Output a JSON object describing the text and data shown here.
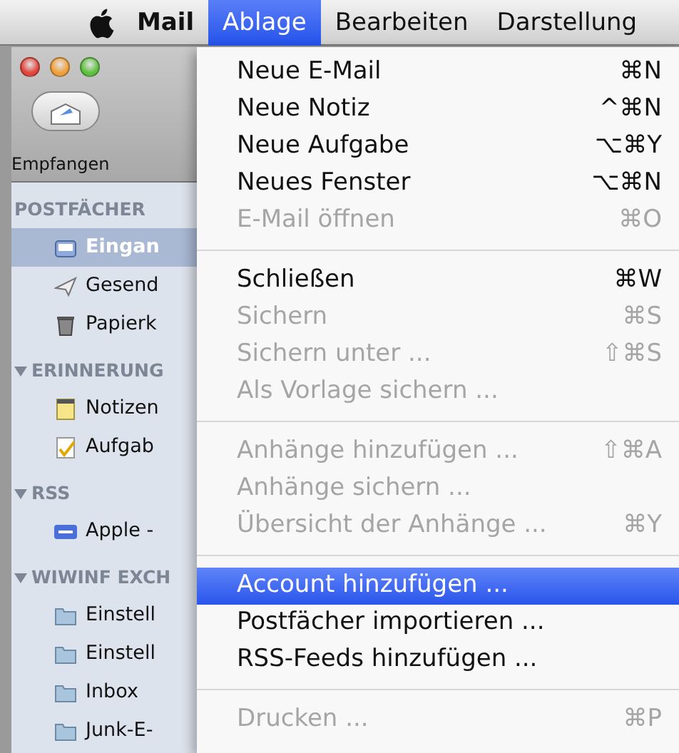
{
  "menu_bar": {
    "app": "Mail",
    "items": [
      {
        "label": "Ablage",
        "selected": true
      },
      {
        "label": "Bearbeiten",
        "selected": false
      },
      {
        "label": "Darstellung",
        "selected": false
      }
    ]
  },
  "sidebar": {
    "toolbar_button": "Empfangen",
    "sections": [
      {
        "title": "POSTFÄCHER",
        "kind": "fixed",
        "expanded": true,
        "items": [
          {
            "label": "Eingan",
            "kind": "inbox",
            "selected": true
          },
          {
            "label": "Gesend",
            "kind": "sent",
            "selected": false
          },
          {
            "label": "Papierk",
            "kind": "trash",
            "selected": false
          }
        ]
      },
      {
        "title": "ERINNERUNG",
        "kind": "collapsible",
        "expanded": true,
        "items": [
          {
            "label": "Notizen",
            "kind": "note",
            "selected": false
          },
          {
            "label": "Aufgab",
            "kind": "todo",
            "selected": false
          }
        ]
      },
      {
        "title": "RSS",
        "kind": "collapsible",
        "expanded": true,
        "items": [
          {
            "label": "Apple -",
            "kind": "rss",
            "selected": false
          }
        ]
      },
      {
        "title": "WIWINF EXCH",
        "kind": "collapsible",
        "expanded": true,
        "items": [
          {
            "label": "Einstell",
            "kind": "folder",
            "selected": false
          },
          {
            "label": "Einstell",
            "kind": "folder",
            "selected": false
          },
          {
            "label": "Inbox",
            "kind": "folder",
            "selected": false
          },
          {
            "label": "Junk-E-",
            "kind": "folder",
            "selected": false
          }
        ]
      }
    ]
  },
  "menu": {
    "items": [
      {
        "kind": "item",
        "label": "Neue E-Mail",
        "shortcut": "⌘N",
        "disabled": false,
        "selected": false
      },
      {
        "kind": "item",
        "label": "Neue Notiz",
        "shortcut": "^⌘N",
        "disabled": false,
        "selected": false
      },
      {
        "kind": "item",
        "label": "Neue Aufgabe",
        "shortcut": "⌥⌘Y",
        "disabled": false,
        "selected": false
      },
      {
        "kind": "item",
        "label": "Neues Fenster",
        "shortcut": "⌥⌘N",
        "disabled": false,
        "selected": false
      },
      {
        "kind": "item",
        "label": "E-Mail öffnen",
        "shortcut": "⌘O",
        "disabled": true,
        "selected": false
      },
      {
        "kind": "separator"
      },
      {
        "kind": "item",
        "label": "Schließen",
        "shortcut": "⌘W",
        "disabled": false,
        "selected": false
      },
      {
        "kind": "item",
        "label": "Sichern",
        "shortcut": "⌘S",
        "disabled": true,
        "selected": false
      },
      {
        "kind": "item",
        "label": "Sichern unter ...",
        "shortcut": "⇧⌘S",
        "disabled": true,
        "selected": false
      },
      {
        "kind": "item",
        "label": "Als Vorlage sichern ...",
        "disabled": true,
        "selected": false
      },
      {
        "kind": "separator"
      },
      {
        "kind": "item",
        "label": "Anhänge hinzufügen ...",
        "shortcut": "⇧⌘A",
        "disabled": true,
        "selected": false
      },
      {
        "kind": "item",
        "label": "Anhänge sichern ...",
        "disabled": true,
        "selected": false
      },
      {
        "kind": "item",
        "label": "Übersicht der Anhänge ...",
        "shortcut": "⌘Y",
        "disabled": true,
        "selected": false
      },
      {
        "kind": "separator"
      },
      {
        "kind": "item",
        "label": "Account hinzufügen ...",
        "disabled": false,
        "selected": true
      },
      {
        "kind": "item",
        "label": "Postfächer importieren ...",
        "disabled": false,
        "selected": false
      },
      {
        "kind": "item",
        "label": "RSS-Feeds hinzufügen ...",
        "disabled": false,
        "selected": false
      },
      {
        "kind": "separator"
      },
      {
        "kind": "item",
        "label": "Drucken ...",
        "shortcut": "⌘P",
        "disabled": true,
        "selected": false
      }
    ]
  }
}
